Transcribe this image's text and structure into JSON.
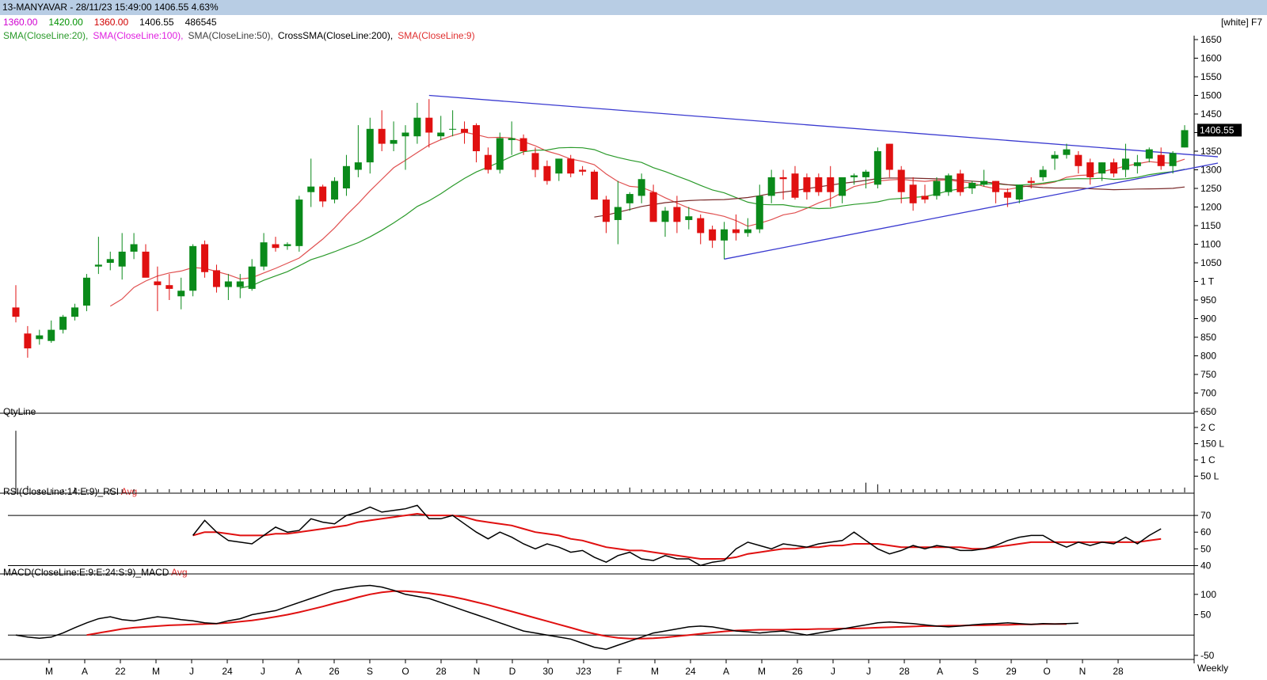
{
  "title": "13-MANYAVAR - 28/11/23 15:49:00 1406.55 4.63%",
  "ohlc": [
    {
      "text": "1360.00",
      "color": "#d000d0"
    },
    {
      "text": "1420.00",
      "color": "#009000"
    },
    {
      "text": "1360.00",
      "color": "#d00000"
    },
    {
      "text": "1406.55",
      "color": "#000000"
    },
    {
      "text": "486545",
      "color": "#000000"
    }
  ],
  "indicators": [
    {
      "text": "SMA(CloseLine:20),",
      "color": "#2a9a2a"
    },
    {
      "text": "SMA(CloseLine:100),",
      "color": "#e020e0"
    },
    {
      "text": "SMA(CloseLine:50),",
      "color": "#404040"
    },
    {
      "text": "CrossSMA(CloseLine:200),",
      "color": "#000000"
    },
    {
      "text": "SMA(CloseLine:9)",
      "color": "#e03030"
    }
  ],
  "theme_label": "[white] F7",
  "last_price_label": "1406.55",
  "panels": {
    "volume_label": "QtyLine",
    "rsi_label": "RSI(CloseLine:14:E:9)_RSI",
    "rsi_avg_label": "Avg",
    "macd_label": "MACD(CloseLine:E:9:E:24:S:9)_MACD",
    "macd_avg_label": "Avg"
  },
  "chart_data": {
    "type": "candlestick",
    "timeframe": "Weekly",
    "price_axis_ticks": [
      "1650",
      "1600",
      "1550",
      "1500",
      "1450",
      "1400",
      "1350",
      "1300",
      "1250",
      "1200",
      "1150",
      "1100",
      "1050",
      "1 T",
      "950",
      "900",
      "850",
      "800",
      "750",
      "700",
      "650"
    ],
    "volume_axis_ticks": [
      "2 C",
      "150 L",
      "1 C",
      "50 L"
    ],
    "rsi_axis_ticks": [
      "70",
      "60",
      "50",
      "40"
    ],
    "macd_axis_ticks": [
      "100",
      "50",
      "-50"
    ],
    "x_axis_labels": [
      "M",
      "A",
      "22",
      "M",
      "J",
      "24",
      "J",
      "A",
      "26",
      "S",
      "O",
      "28",
      "N",
      "D",
      "30",
      "J23",
      "F",
      "M",
      "24",
      "A",
      "M",
      "26",
      "J",
      "J",
      "28",
      "A",
      "S",
      "29",
      "O",
      "N",
      "28"
    ],
    "ylim": [
      650,
      1650
    ],
    "rsi_levels": [
      40,
      70
    ],
    "candles": [
      {
        "o": 930,
        "h": 990,
        "l": 890,
        "c": 905
      },
      {
        "o": 860,
        "h": 880,
        "l": 795,
        "c": 820
      },
      {
        "o": 845,
        "h": 870,
        "l": 830,
        "c": 855
      },
      {
        "o": 840,
        "h": 895,
        "l": 835,
        "c": 870
      },
      {
        "o": 870,
        "h": 910,
        "l": 860,
        "c": 905
      },
      {
        "o": 905,
        "h": 940,
        "l": 895,
        "c": 930
      },
      {
        "o": 935,
        "h": 1020,
        "l": 920,
        "c": 1010
      },
      {
        "o": 1040,
        "h": 1120,
        "l": 1020,
        "c": 1045
      },
      {
        "o": 1050,
        "h": 1080,
        "l": 1030,
        "c": 1060
      },
      {
        "o": 1040,
        "h": 1130,
        "l": 1005,
        "c": 1080
      },
      {
        "o": 1080,
        "h": 1130,
        "l": 1060,
        "c": 1100
      },
      {
        "o": 1080,
        "h": 1100,
        "l": 1020,
        "c": 1010
      },
      {
        "o": 1000,
        "h": 1040,
        "l": 920,
        "c": 990
      },
      {
        "o": 990,
        "h": 1020,
        "l": 950,
        "c": 980
      },
      {
        "o": 960,
        "h": 1010,
        "l": 925,
        "c": 975
      },
      {
        "o": 975,
        "h": 1100,
        "l": 960,
        "c": 1095
      },
      {
        "o": 1100,
        "h": 1110,
        "l": 1010,
        "c": 1025
      },
      {
        "o": 1030,
        "h": 1045,
        "l": 970,
        "c": 985
      },
      {
        "o": 985,
        "h": 1020,
        "l": 950,
        "c": 1000
      },
      {
        "o": 985,
        "h": 1020,
        "l": 955,
        "c": 1000
      },
      {
        "o": 980,
        "h": 1060,
        "l": 975,
        "c": 1040
      },
      {
        "o": 1040,
        "h": 1130,
        "l": 1030,
        "c": 1105
      },
      {
        "o": 1100,
        "h": 1120,
        "l": 1080,
        "c": 1090
      },
      {
        "o": 1095,
        "h": 1105,
        "l": 1085,
        "c": 1100
      },
      {
        "o": 1095,
        "h": 1230,
        "l": 1080,
        "c": 1220
      },
      {
        "o": 1240,
        "h": 1330,
        "l": 1200,
        "c": 1255
      },
      {
        "o": 1255,
        "h": 1260,
        "l": 1200,
        "c": 1215
      },
      {
        "o": 1220,
        "h": 1280,
        "l": 1210,
        "c": 1270
      },
      {
        "o": 1250,
        "h": 1340,
        "l": 1230,
        "c": 1310
      },
      {
        "o": 1300,
        "h": 1420,
        "l": 1280,
        "c": 1320
      },
      {
        "o": 1320,
        "h": 1440,
        "l": 1290,
        "c": 1410
      },
      {
        "o": 1410,
        "h": 1460,
        "l": 1350,
        "c": 1370
      },
      {
        "o": 1370,
        "h": 1430,
        "l": 1350,
        "c": 1380
      },
      {
        "o": 1390,
        "h": 1420,
        "l": 1300,
        "c": 1400
      },
      {
        "o": 1390,
        "h": 1480,
        "l": 1370,
        "c": 1440
      },
      {
        "o": 1440,
        "h": 1490,
        "l": 1360,
        "c": 1400
      },
      {
        "o": 1390,
        "h": 1445,
        "l": 1380,
        "c": 1400
      },
      {
        "o": 1410,
        "h": 1460,
        "l": 1390,
        "c": 1410
      },
      {
        "o": 1410,
        "h": 1430,
        "l": 1370,
        "c": 1400
      },
      {
        "o": 1420,
        "h": 1425,
        "l": 1320,
        "c": 1350
      },
      {
        "o": 1340,
        "h": 1360,
        "l": 1290,
        "c": 1300
      },
      {
        "o": 1300,
        "h": 1400,
        "l": 1290,
        "c": 1385
      },
      {
        "o": 1380,
        "h": 1430,
        "l": 1340,
        "c": 1385
      },
      {
        "o": 1385,
        "h": 1395,
        "l": 1340,
        "c": 1350
      },
      {
        "o": 1345,
        "h": 1360,
        "l": 1280,
        "c": 1300
      },
      {
        "o": 1310,
        "h": 1325,
        "l": 1260,
        "c": 1270
      },
      {
        "o": 1290,
        "h": 1300,
        "l": 1270,
        "c": 1330
      },
      {
        "o": 1330,
        "h": 1340,
        "l": 1280,
        "c": 1290
      },
      {
        "o": 1300,
        "h": 1310,
        "l": 1285,
        "c": 1295
      },
      {
        "o": 1295,
        "h": 1300,
        "l": 1230,
        "c": 1220
      },
      {
        "o": 1220,
        "h": 1230,
        "l": 1130,
        "c": 1160
      },
      {
        "o": 1165,
        "h": 1270,
        "l": 1100,
        "c": 1200
      },
      {
        "o": 1210,
        "h": 1240,
        "l": 1190,
        "c": 1235
      },
      {
        "o": 1230,
        "h": 1290,
        "l": 1210,
        "c": 1275
      },
      {
        "o": 1240,
        "h": 1260,
        "l": 1165,
        "c": 1160
      },
      {
        "o": 1160,
        "h": 1200,
        "l": 1120,
        "c": 1190
      },
      {
        "o": 1200,
        "h": 1230,
        "l": 1130,
        "c": 1160
      },
      {
        "o": 1165,
        "h": 1200,
        "l": 1140,
        "c": 1175
      },
      {
        "o": 1170,
        "h": 1180,
        "l": 1100,
        "c": 1130
      },
      {
        "o": 1140,
        "h": 1150,
        "l": 1090,
        "c": 1110
      },
      {
        "o": 1110,
        "h": 1160,
        "l": 1060,
        "c": 1140
      },
      {
        "o": 1140,
        "h": 1180,
        "l": 1110,
        "c": 1130
      },
      {
        "o": 1130,
        "h": 1170,
        "l": 1120,
        "c": 1140
      },
      {
        "o": 1140,
        "h": 1260,
        "l": 1130,
        "c": 1230
      },
      {
        "o": 1230,
        "h": 1300,
        "l": 1210,
        "c": 1280
      },
      {
        "o": 1280,
        "h": 1300,
        "l": 1220,
        "c": 1275
      },
      {
        "o": 1290,
        "h": 1310,
        "l": 1220,
        "c": 1225
      },
      {
        "o": 1280,
        "h": 1290,
        "l": 1220,
        "c": 1240
      },
      {
        "o": 1280,
        "h": 1290,
        "l": 1230,
        "c": 1240
      },
      {
        "o": 1280,
        "h": 1310,
        "l": 1200,
        "c": 1240
      },
      {
        "o": 1230,
        "h": 1270,
        "l": 1210,
        "c": 1280
      },
      {
        "o": 1280,
        "h": 1290,
        "l": 1260,
        "c": 1285
      },
      {
        "o": 1280,
        "h": 1300,
        "l": 1250,
        "c": 1295
      },
      {
        "o": 1260,
        "h": 1360,
        "l": 1250,
        "c": 1350
      },
      {
        "o": 1370,
        "h": 1370,
        "l": 1280,
        "c": 1300
      },
      {
        "o": 1300,
        "h": 1310,
        "l": 1210,
        "c": 1240
      },
      {
        "o": 1260,
        "h": 1280,
        "l": 1190,
        "c": 1210
      },
      {
        "o": 1230,
        "h": 1260,
        "l": 1210,
        "c": 1220
      },
      {
        "o": 1230,
        "h": 1280,
        "l": 1220,
        "c": 1270
      },
      {
        "o": 1240,
        "h": 1290,
        "l": 1230,
        "c": 1285
      },
      {
        "o": 1290,
        "h": 1300,
        "l": 1230,
        "c": 1240
      },
      {
        "o": 1250,
        "h": 1270,
        "l": 1235,
        "c": 1265
      },
      {
        "o": 1260,
        "h": 1300,
        "l": 1255,
        "c": 1270
      },
      {
        "o": 1270,
        "h": 1270,
        "l": 1210,
        "c": 1240
      },
      {
        "o": 1240,
        "h": 1250,
        "l": 1200,
        "c": 1225
      },
      {
        "o": 1220,
        "h": 1260,
        "l": 1210,
        "c": 1260
      },
      {
        "o": 1270,
        "h": 1280,
        "l": 1250,
        "c": 1265
      },
      {
        "o": 1280,
        "h": 1310,
        "l": 1270,
        "c": 1300
      },
      {
        "o": 1330,
        "h": 1350,
        "l": 1300,
        "c": 1340
      },
      {
        "o": 1340,
        "h": 1370,
        "l": 1330,
        "c": 1355
      },
      {
        "o": 1340,
        "h": 1350,
        "l": 1290,
        "c": 1310
      },
      {
        "o": 1320,
        "h": 1330,
        "l": 1260,
        "c": 1280
      },
      {
        "o": 1290,
        "h": 1320,
        "l": 1270,
        "c": 1320
      },
      {
        "o": 1320,
        "h": 1330,
        "l": 1280,
        "c": 1290
      },
      {
        "o": 1300,
        "h": 1370,
        "l": 1280,
        "c": 1330
      },
      {
        "o": 1310,
        "h": 1340,
        "l": 1290,
        "c": 1320
      },
      {
        "o": 1330,
        "h": 1360,
        "l": 1320,
        "c": 1355
      },
      {
        "o": 1340,
        "h": 1360,
        "l": 1300,
        "c": 1310
      },
      {
        "o": 1310,
        "h": 1350,
        "l": 1290,
        "c": 1345
      },
      {
        "o": 1360,
        "h": 1420,
        "l": 1360,
        "c": 1406.55
      }
    ],
    "volume": [
      1.9,
      0.2,
      0.1,
      0.1,
      0.1,
      0.15,
      0.1,
      0.1,
      0.1,
      0.1,
      0.1,
      0.1,
      0.1,
      0.1,
      0.1,
      0.1,
      0.1,
      0.1,
      0.1,
      0.1,
      0.1,
      0.1,
      0.1,
      0.1,
      0.1,
      0.1,
      0.1,
      0.1,
      0.1,
      0.1,
      0.15,
      0.1,
      0.1,
      0.1,
      0.1,
      0.1,
      0.1,
      0.1,
      0.1,
      0.1,
      0.1,
      0.1,
      0.1,
      0.1,
      0.1,
      0.1,
      0.1,
      0.1,
      0.1,
      0.1,
      0.1,
      0.1,
      0.15,
      0.1,
      0.1,
      0.1,
      0.1,
      0.1,
      0.1,
      0.1,
      0.1,
      0.1,
      0.1,
      0.1,
      0.1,
      0.1,
      0.1,
      0.1,
      0.1,
      0.1,
      0.1,
      0.1,
      0.3,
      0.25,
      0.1,
      0.1,
      0.1,
      0.1,
      0.1,
      0.1,
      0.1,
      0.1,
      0.1,
      0.1,
      0.1,
      0.1,
      0.1,
      0.1,
      0.1,
      0.1,
      0.1,
      0.1,
      0.1,
      0.1,
      0.1,
      0.1,
      0.1,
      0.1,
      0.1,
      0.15
    ],
    "rsi": [
      null,
      null,
      null,
      null,
      null,
      null,
      null,
      null,
      null,
      null,
      null,
      null,
      null,
      null,
      null,
      58,
      67,
      60,
      55,
      54,
      53,
      58,
      63,
      60,
      61,
      68,
      66,
      65,
      70,
      72,
      75,
      72,
      73,
      74,
      76,
      68,
      68,
      70,
      65,
      60,
      56,
      60,
      57,
      53,
      50,
      53,
      51,
      48,
      49,
      45,
      42,
      46,
      48,
      44,
      43,
      46,
      44,
      44,
      40,
      42,
      43,
      50,
      54,
      52,
      50,
      53,
      52,
      51,
      53,
      54,
      55,
      60,
      55,
      50,
      47,
      49,
      52,
      50,
      52,
      51,
      49,
      49,
      50,
      52,
      55,
      57,
      58,
      58,
      54,
      51,
      54,
      52,
      54,
      53,
      57,
      53,
      58,
      62
    ],
    "rsi_avg": [
      null,
      null,
      null,
      null,
      null,
      null,
      null,
      null,
      null,
      null,
      null,
      null,
      null,
      null,
      null,
      58,
      60,
      60,
      59,
      58,
      58,
      58,
      59,
      59,
      60,
      61,
      62,
      63,
      64,
      66,
      67,
      68,
      69,
      70,
      71,
      70,
      70,
      70,
      69,
      67,
      66,
      65,
      64,
      62,
      60,
      59,
      58,
      56,
      55,
      53,
      51,
      50,
      49,
      49,
      48,
      47,
      46,
      45,
      44,
      44,
      44,
      45,
      47,
      48,
      49,
      50,
      50,
      51,
      51,
      52,
      52,
      53,
      53,
      53,
      52,
      51,
      51,
      51,
      51,
      51,
      51,
      50,
      50,
      51,
      52,
      53,
      54,
      54,
      54,
      54,
      54,
      54,
      54,
      54,
      54,
      54,
      55,
      56
    ],
    "macd": [
      0,
      -5,
      -8,
      -5,
      5,
      18,
      30,
      40,
      45,
      38,
      35,
      40,
      45,
      42,
      38,
      35,
      30,
      28,
      35,
      40,
      50,
      55,
      60,
      70,
      80,
      90,
      100,
      110,
      115,
      120,
      122,
      118,
      110,
      100,
      95,
      90,
      80,
      70,
      60,
      50,
      40,
      30,
      20,
      10,
      5,
      0,
      -5,
      -10,
      -20,
      -30,
      -35,
      -25,
      -15,
      -5,
      5,
      10,
      15,
      20,
      22,
      20,
      15,
      10,
      8,
      5,
      8,
      10,
      5,
      0,
      5,
      10,
      15,
      20,
      25,
      30,
      32,
      30,
      28,
      25,
      22,
      20,
      22,
      25,
      27,
      28,
      30,
      28,
      26,
      28,
      27,
      28,
      29
    ],
    "macd_avg": [
      null,
      null,
      null,
      null,
      null,
      null,
      0,
      5,
      10,
      15,
      18,
      20,
      22,
      24,
      25,
      26,
      27,
      28,
      30,
      33,
      36,
      40,
      45,
      50,
      56,
      63,
      70,
      78,
      85,
      93,
      100,
      105,
      108,
      108,
      106,
      103,
      99,
      94,
      88,
      81,
      74,
      66,
      58,
      50,
      42,
      34,
      26,
      18,
      10,
      3,
      -3,
      -7,
      -9,
      -9,
      -8,
      -6,
      -3,
      0,
      3,
      6,
      9,
      11,
      12,
      13,
      13,
      13,
      14,
      14,
      15,
      15,
      16,
      16,
      17,
      18,
      19,
      20,
      21,
      22,
      22,
      23,
      23,
      24,
      24,
      25,
      25,
      26,
      26,
      27,
      27,
      27
    ]
  }
}
